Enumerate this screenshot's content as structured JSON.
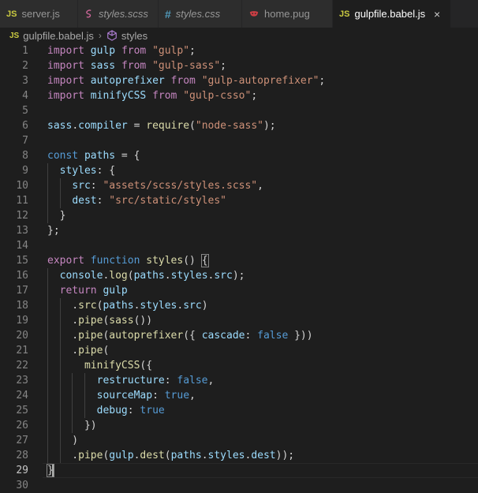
{
  "tabs": [
    {
      "label": "server.js",
      "icon": "js-icon",
      "icon_text": "JS",
      "icon_color": "#cbcb41",
      "active": false,
      "italic": false
    },
    {
      "label": "styles.scss",
      "icon": "sass-icon",
      "icon_text": "",
      "icon_color": "#cd6799",
      "active": false,
      "italic": true
    },
    {
      "label": "styles.css",
      "icon": "css-icon",
      "icon_text": "#",
      "icon_color": "#519aba",
      "active": false,
      "italic": true
    },
    {
      "label": "home.pug",
      "icon": "pug-icon",
      "icon_text": "",
      "icon_color": "#cc3e44",
      "active": false,
      "italic": false
    },
    {
      "label": "gulpfile.babel.js",
      "icon": "js-icon",
      "icon_text": "JS",
      "icon_color": "#cbcb41",
      "active": true,
      "italic": false,
      "close": "×"
    }
  ],
  "breadcrumb": {
    "file": "gulpfile.babel.js",
    "file_icon_text": "JS",
    "symbol": "styles"
  },
  "editor": {
    "current_line": 29,
    "lines": [
      {
        "n": "1",
        "tokens": [
          [
            "kw",
            "import"
          ],
          [
            "pl",
            " "
          ],
          [
            "va",
            "gulp"
          ],
          [
            "pl",
            " "
          ],
          [
            "kw",
            "from"
          ],
          [
            "pl",
            " "
          ],
          [
            "st",
            "\"gulp\""
          ],
          [
            "pl",
            ";"
          ]
        ]
      },
      {
        "n": "2",
        "tokens": [
          [
            "kw",
            "import"
          ],
          [
            "pl",
            " "
          ],
          [
            "va",
            "sass"
          ],
          [
            "pl",
            " "
          ],
          [
            "kw",
            "from"
          ],
          [
            "pl",
            " "
          ],
          [
            "st",
            "\"gulp-sass\""
          ],
          [
            "pl",
            ";"
          ]
        ]
      },
      {
        "n": "3",
        "tokens": [
          [
            "kw",
            "import"
          ],
          [
            "pl",
            " "
          ],
          [
            "va",
            "autoprefixer"
          ],
          [
            "pl",
            " "
          ],
          [
            "kw",
            "from"
          ],
          [
            "pl",
            " "
          ],
          [
            "st",
            "\"gulp-autoprefixer\""
          ],
          [
            "pl",
            ";"
          ]
        ]
      },
      {
        "n": "4",
        "tokens": [
          [
            "kw",
            "import"
          ],
          [
            "pl",
            " "
          ],
          [
            "va",
            "minifyCSS"
          ],
          [
            "pl",
            " "
          ],
          [
            "kw",
            "from"
          ],
          [
            "pl",
            " "
          ],
          [
            "st",
            "\"gulp-csso\""
          ],
          [
            "pl",
            ";"
          ]
        ]
      },
      {
        "n": "5",
        "tokens": []
      },
      {
        "n": "6",
        "tokens": [
          [
            "va",
            "sass"
          ],
          [
            "pl",
            "."
          ],
          [
            "va",
            "compiler"
          ],
          [
            "pl",
            " = "
          ],
          [
            "fn",
            "require"
          ],
          [
            "pl",
            "("
          ],
          [
            "st",
            "\"node-sass\""
          ],
          [
            "pl",
            ");"
          ]
        ]
      },
      {
        "n": "7",
        "tokens": []
      },
      {
        "n": "8",
        "tokens": [
          [
            "bl",
            "const"
          ],
          [
            "pl",
            " "
          ],
          [
            "va",
            "paths"
          ],
          [
            "pl",
            " = {"
          ]
        ]
      },
      {
        "n": "9",
        "tokens": [
          [
            "pl",
            "  "
          ],
          [
            "va",
            "styles"
          ],
          [
            "pl",
            ": {"
          ]
        ]
      },
      {
        "n": "10",
        "tokens": [
          [
            "pl",
            "    "
          ],
          [
            "va",
            "src"
          ],
          [
            "pl",
            ": "
          ],
          [
            "st",
            "\"assets/scss/styles.scss\""
          ],
          [
            "pl",
            ","
          ]
        ]
      },
      {
        "n": "11",
        "tokens": [
          [
            "pl",
            "    "
          ],
          [
            "va",
            "dest"
          ],
          [
            "pl",
            ": "
          ],
          [
            "st",
            "\"src/static/styles\""
          ]
        ]
      },
      {
        "n": "12",
        "tokens": [
          [
            "pl",
            "  }"
          ]
        ]
      },
      {
        "n": "13",
        "tokens": [
          [
            "pl",
            "};"
          ]
        ]
      },
      {
        "n": "14",
        "tokens": []
      },
      {
        "n": "15",
        "tokens": [
          [
            "kw",
            "export"
          ],
          [
            "pl",
            " "
          ],
          [
            "bl",
            "function"
          ],
          [
            "pl",
            " "
          ],
          [
            "fn",
            "styles"
          ],
          [
            "pl",
            "() "
          ],
          [
            "hl",
            "{"
          ]
        ]
      },
      {
        "n": "16",
        "tokens": [
          [
            "pl",
            "  "
          ],
          [
            "va",
            "console"
          ],
          [
            "pl",
            "."
          ],
          [
            "fn",
            "log"
          ],
          [
            "pl",
            "("
          ],
          [
            "va",
            "paths"
          ],
          [
            "pl",
            "."
          ],
          [
            "va",
            "styles"
          ],
          [
            "pl",
            "."
          ],
          [
            "va",
            "src"
          ],
          [
            "pl",
            ");"
          ]
        ]
      },
      {
        "n": "17",
        "tokens": [
          [
            "pl",
            "  "
          ],
          [
            "kw",
            "return"
          ],
          [
            "pl",
            " "
          ],
          [
            "va",
            "gulp"
          ]
        ]
      },
      {
        "n": "18",
        "tokens": [
          [
            "pl",
            "    ."
          ],
          [
            "fn",
            "src"
          ],
          [
            "pl",
            "("
          ],
          [
            "va",
            "paths"
          ],
          [
            "pl",
            "."
          ],
          [
            "va",
            "styles"
          ],
          [
            "pl",
            "."
          ],
          [
            "va",
            "src"
          ],
          [
            "pl",
            ")"
          ]
        ]
      },
      {
        "n": "19",
        "tokens": [
          [
            "pl",
            "    ."
          ],
          [
            "fn",
            "pipe"
          ],
          [
            "pl",
            "("
          ],
          [
            "fn",
            "sass"
          ],
          [
            "pl",
            "())"
          ]
        ]
      },
      {
        "n": "20",
        "tokens": [
          [
            "pl",
            "    ."
          ],
          [
            "fn",
            "pipe"
          ],
          [
            "pl",
            "("
          ],
          [
            "fn",
            "autoprefixer"
          ],
          [
            "pl",
            "({ "
          ],
          [
            "va",
            "cascade"
          ],
          [
            "pl",
            ": "
          ],
          [
            "bl",
            "false"
          ],
          [
            "pl",
            " }))"
          ]
        ]
      },
      {
        "n": "21",
        "tokens": [
          [
            "pl",
            "    ."
          ],
          [
            "fn",
            "pipe"
          ],
          [
            "pl",
            "("
          ]
        ]
      },
      {
        "n": "22",
        "tokens": [
          [
            "pl",
            "      "
          ],
          [
            "fn",
            "minifyCSS"
          ],
          [
            "pl",
            "({"
          ]
        ]
      },
      {
        "n": "23",
        "tokens": [
          [
            "pl",
            "        "
          ],
          [
            "va",
            "restructure"
          ],
          [
            "pl",
            ": "
          ],
          [
            "bl",
            "false"
          ],
          [
            "pl",
            ","
          ]
        ]
      },
      {
        "n": "24",
        "tokens": [
          [
            "pl",
            "        "
          ],
          [
            "va",
            "sourceMap"
          ],
          [
            "pl",
            ": "
          ],
          [
            "bl",
            "true"
          ],
          [
            "pl",
            ","
          ]
        ]
      },
      {
        "n": "25",
        "tokens": [
          [
            "pl",
            "        "
          ],
          [
            "va",
            "debug"
          ],
          [
            "pl",
            ": "
          ],
          [
            "bl",
            "true"
          ]
        ]
      },
      {
        "n": "26",
        "tokens": [
          [
            "pl",
            "      })"
          ]
        ]
      },
      {
        "n": "27",
        "tokens": [
          [
            "pl",
            "    )"
          ]
        ]
      },
      {
        "n": "28",
        "tokens": [
          [
            "pl",
            "    ."
          ],
          [
            "fn",
            "pipe"
          ],
          [
            "pl",
            "("
          ],
          [
            "va",
            "gulp"
          ],
          [
            "pl",
            "."
          ],
          [
            "fn",
            "dest"
          ],
          [
            "pl",
            "("
          ],
          [
            "va",
            "paths"
          ],
          [
            "pl",
            "."
          ],
          [
            "va",
            "styles"
          ],
          [
            "pl",
            "."
          ],
          [
            "va",
            "dest"
          ],
          [
            "pl",
            "));"
          ]
        ]
      },
      {
        "n": "29",
        "tokens": [
          [
            "hl",
            "}"
          ],
          [
            "cur",
            ""
          ]
        ]
      },
      {
        "n": "30",
        "tokens": []
      }
    ]
  }
}
